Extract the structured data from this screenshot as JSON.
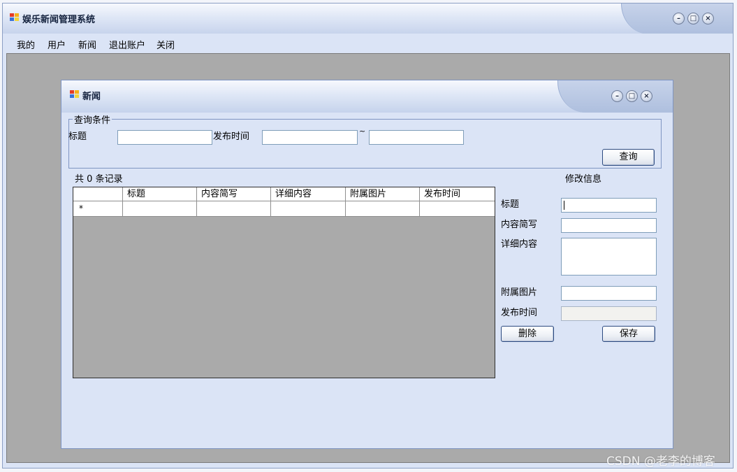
{
  "app": {
    "title": "娱乐新闻管理系统",
    "controls": {
      "minimize": "–",
      "maximize": "□",
      "close": "×"
    }
  },
  "menu": {
    "items": [
      {
        "label": "我的"
      },
      {
        "label": "用户"
      },
      {
        "label": "新闻"
      },
      {
        "label": "退出账户"
      },
      {
        "label": "关闭"
      }
    ]
  },
  "child": {
    "title": "新闻",
    "controls": {
      "minimize": "–",
      "maximize": "□",
      "close": "×"
    },
    "query": {
      "group_title": "查询条件",
      "title_label": "标题",
      "title_value": "",
      "time_label": "发布时间",
      "time_from": "",
      "separator": "~",
      "time_to": "",
      "search_button": "查询"
    },
    "records": {
      "prefix": "共",
      "count": "0",
      "suffix": "条记录"
    },
    "grid": {
      "columns": [
        "标题",
        "内容简写",
        "详细内容",
        "附属图片",
        "发布时间"
      ],
      "new_row_marker": "*"
    },
    "edit": {
      "title": "修改信息",
      "fields": {
        "title_label": "标题",
        "title_value": "",
        "summary_label": "内容简写",
        "summary_value": "",
        "detail_label": "详细内容",
        "detail_value": "",
        "image_label": "附属图片",
        "image_value": "",
        "time_label": "发布时间",
        "time_value": ""
      },
      "delete_button": "删除",
      "save_button": "保存"
    }
  },
  "watermark": "CSDN @老李的博客",
  "icons": {
    "app": "windows-flag-icon",
    "child": "windows-flag-icon"
  },
  "colors": {
    "window_bg": "#dbe4f6",
    "mdi_bg": "#aaaaaa",
    "border": "#7f95c2"
  }
}
